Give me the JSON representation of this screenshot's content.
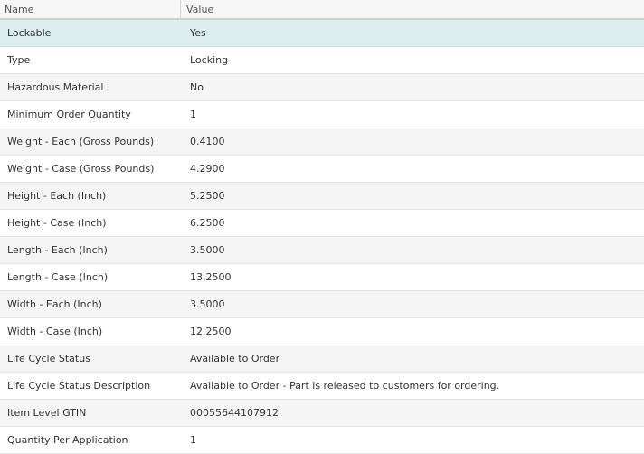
{
  "table": {
    "columns": {
      "name": "Name",
      "value": "Value"
    },
    "selected_row_color": "#dcedf0",
    "rows": [
      {
        "name": "Lockable",
        "value": "Yes"
      },
      {
        "name": "Type",
        "value": "Locking"
      },
      {
        "name": "Hazardous Material",
        "value": "No"
      },
      {
        "name": "Minimum Order Quantity",
        "value": "1"
      },
      {
        "name": "Weight - Each (Gross Pounds)",
        "value": "0.4100"
      },
      {
        "name": "Weight - Case (Gross Pounds)",
        "value": "4.2900"
      },
      {
        "name": "Height - Each (Inch)",
        "value": "5.2500"
      },
      {
        "name": "Height - Case (Inch)",
        "value": "6.2500"
      },
      {
        "name": "Length - Each (Inch)",
        "value": "3.5000"
      },
      {
        "name": "Length - Case (Inch)",
        "value": "13.2500"
      },
      {
        "name": "Width - Each (Inch)",
        "value": "3.5000"
      },
      {
        "name": "Width - Case (Inch)",
        "value": "12.2500"
      },
      {
        "name": "Life Cycle Status",
        "value": "Available to Order"
      },
      {
        "name": "Life Cycle Status Description",
        "value": "Available to Order - Part is released to customers for ordering."
      },
      {
        "name": "Item Level GTIN",
        "value": "00055644107912"
      },
      {
        "name": "Quantity Per Application",
        "value": "1"
      }
    ]
  }
}
